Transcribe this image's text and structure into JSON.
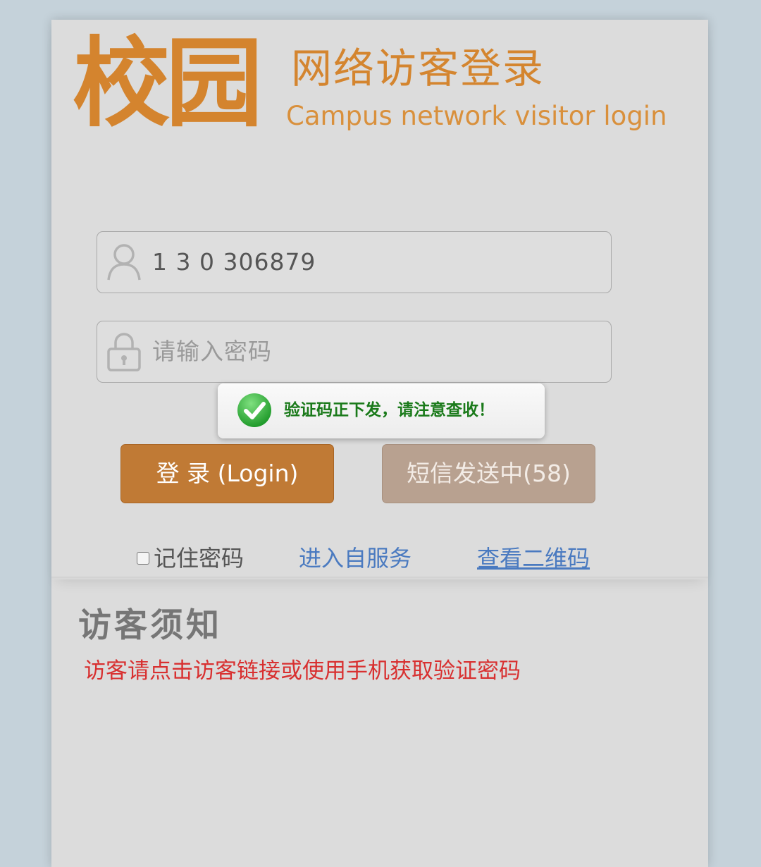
{
  "logo": {
    "big_text": "校园",
    "title": "网络访客登录",
    "subtitle": "Campus network visitor login"
  },
  "form": {
    "username_value": "1 3 0 306879",
    "username_icon": "user-icon",
    "password_placeholder": "请输入密码",
    "password_icon": "lock-icon"
  },
  "toast": {
    "icon": "check-icon",
    "message": "验证码正下发，请注意查收！",
    "color": "#1a7a1a"
  },
  "buttons": {
    "login_label": "登 录 (Login)",
    "sms_label": "短信发送中(58)"
  },
  "options": {
    "remember_label": "记住密码",
    "remember_checked": false,
    "self_service_label": "进入自服务",
    "qrcode_label": "查看二维码"
  },
  "notice": {
    "title": "访客须知",
    "text": "访客请点击访客链接或使用手机获取验证密码"
  },
  "colors": {
    "brand": "#d4842e",
    "login_button": "#c07a35",
    "sms_button": "#b8a190",
    "link": "#4a7ac0",
    "notice_text": "#d83030"
  }
}
